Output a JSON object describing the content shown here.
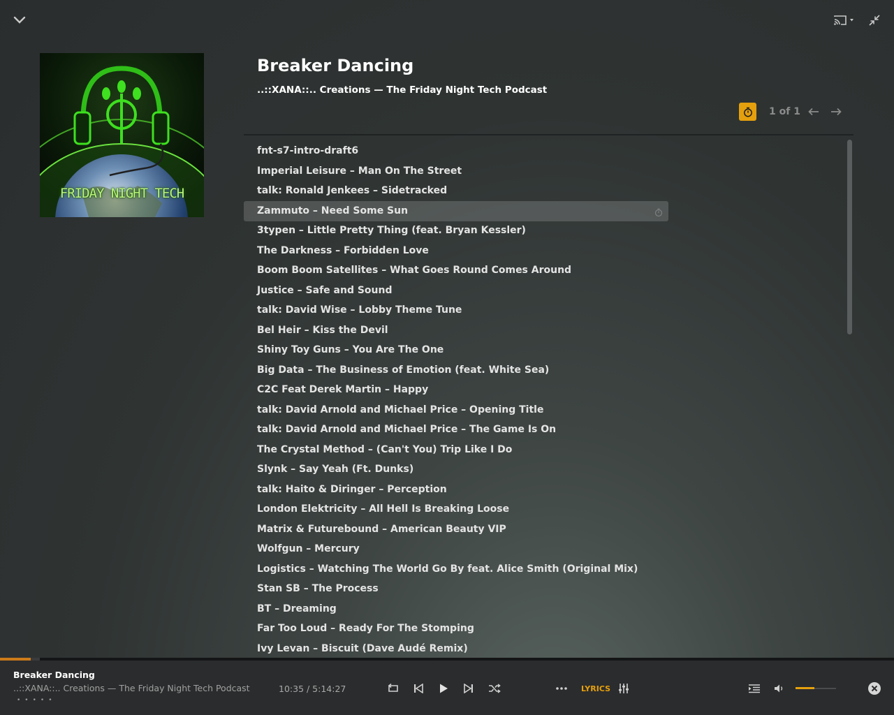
{
  "header": {
    "title": "Breaker Dancing",
    "subtitle": "..::XANA::.. Creations — The Friday Night Tech Podcast",
    "page_count": "1 of 1"
  },
  "artwork": {
    "text": "FRIDAY NIGHT TECH"
  },
  "tracks": [
    "fnt-s7-intro-draft6",
    "Imperial Leisure – Man On The Street",
    "talk: Ronald Jenkees – Sidetracked",
    "Zammuto – Need Some Sun",
    "3typen – Little Pretty Thing (feat. Bryan Kessler)",
    "The Darkness – Forbidden Love",
    "Boom Boom Satellites – What Goes Round Comes Around",
    "Justice – Safe and Sound",
    "talk: David Wise – Lobby Theme Tune",
    "Bel Heir – Kiss the Devil",
    "Shiny Toy Guns – You Are The One",
    "Big Data – The Business of Emotion (feat. White Sea)",
    "C2C Feat Derek Martin – Happy",
    "talk: David Arnold and Michael Price – Opening Title",
    "talk: David Arnold and Michael Price – The Game Is On",
    "The Crystal Method – (Can't You) Trip Like I Do",
    "Slynk – Say Yeah (Ft. Dunks)",
    "talk: Haito & Diringer – Perception",
    "London Elektricity – All Hell Is Breaking Loose",
    "Matrix & Futurebound – American Beauty VIP",
    "Wolfgun – Mercury",
    "Logistics – Watching The World Go By feat. Alice Smith (Original Mix)",
    "Stan SB – The Process",
    "BT – Dreaming",
    "Far Too Loud – Ready For The Stomping",
    "Ivy Levan – Biscuit (Dave Audé Remix)"
  ],
  "selected_track_index": 3,
  "player": {
    "title": "Breaker Dancing",
    "subtitle": "..::XANA::.. Creations — The Friday Night Tech Podcast",
    "time": "10:35 / 5:14:27",
    "lyrics_label": "LYRICS",
    "progress_fraction": 0.034,
    "volume_fraction": 0.47
  },
  "colors": {
    "accent": "#e5a00d",
    "progress": "#cc7b19",
    "background": "#2f3433",
    "player_bar": "#2b2c2d"
  },
  "icons": [
    "chevron-down-icon",
    "cast-icon",
    "minimize-icon",
    "timer-icon",
    "arrow-left-icon",
    "arrow-right-icon",
    "repeat-icon",
    "previous-icon",
    "play-icon",
    "next-icon",
    "shuffle-icon",
    "more-icon",
    "equalizer-icon",
    "queue-icon",
    "volume-icon",
    "close-icon"
  ]
}
